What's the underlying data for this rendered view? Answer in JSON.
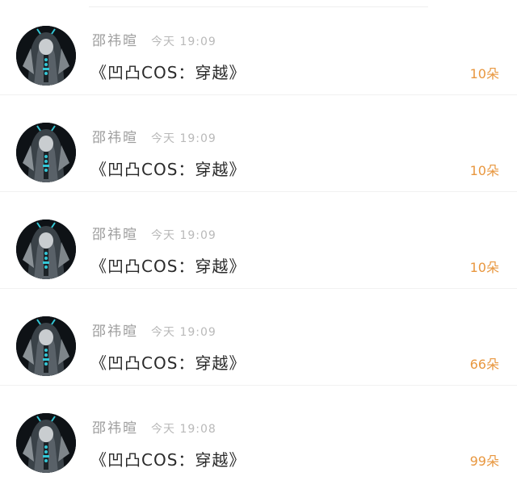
{
  "feed": {
    "rows": [
      {
        "username": "邵祎暄",
        "time": "今天 19:09",
        "message": "《凹凸COS：穿越》",
        "gift_count": "10朵"
      },
      {
        "username": "邵祎暄",
        "time": "今天 19:09",
        "message": "《凹凸COS：穿越》",
        "gift_count": "10朵"
      },
      {
        "username": "邵祎暄",
        "time": "今天 19:09",
        "message": "《凹凸COS：穿越》",
        "gift_count": "10朵"
      },
      {
        "username": "邵祎暄",
        "time": "今天 19:09",
        "message": "《凹凸COS：穿越》",
        "gift_count": "66朵"
      },
      {
        "username": "邵祎暄",
        "time": "今天 19:08",
        "message": "《凹凸COS：穿越》",
        "gift_count": "99朵"
      }
    ]
  },
  "colors": {
    "username": "#9b9b9b",
    "time": "#b9b9b9",
    "message": "#2a2a2a",
    "gift_count": "#e8973f",
    "avatar_bg": "#0e1216",
    "avatar_accent": "#34c7d6"
  }
}
